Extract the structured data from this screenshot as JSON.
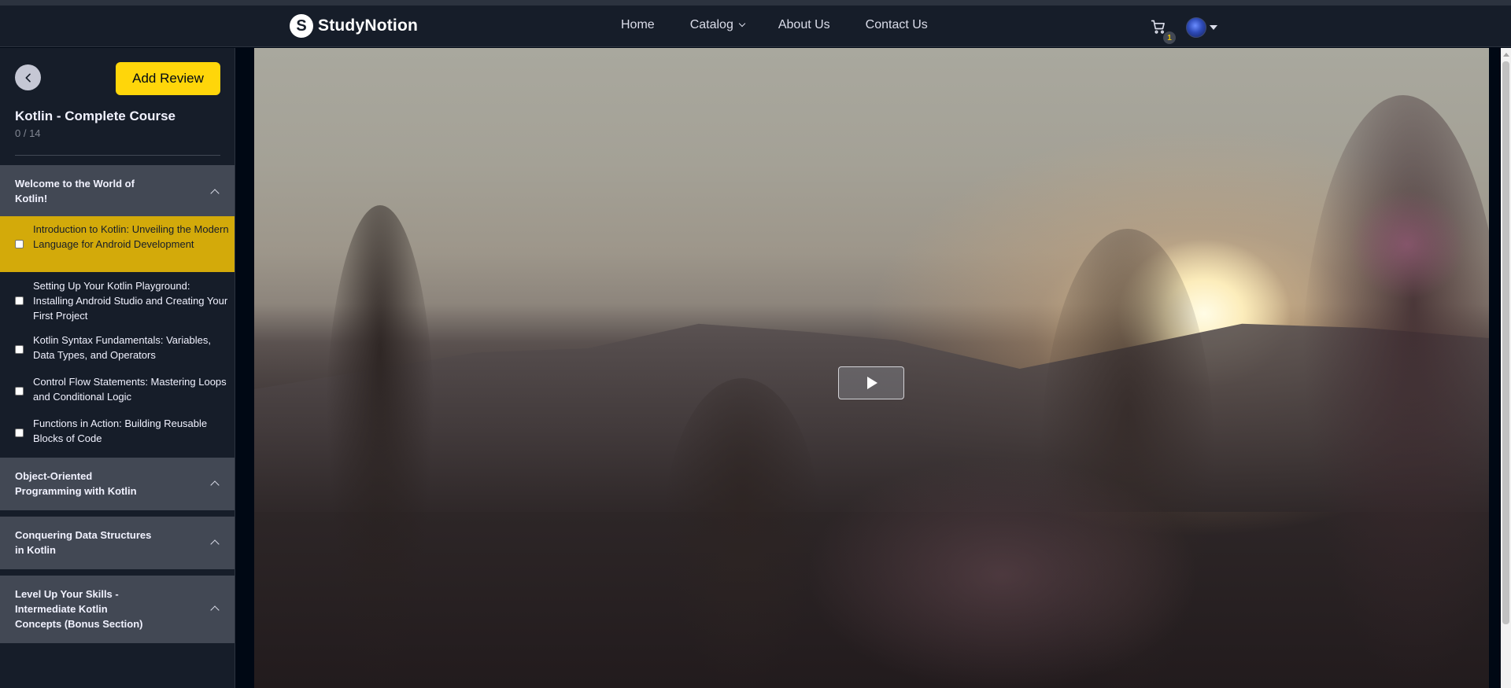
{
  "navbar": {
    "logo_letter": "S",
    "brand": "StudyNotion",
    "links": [
      {
        "label": "Home"
      },
      {
        "label": "Catalog"
      },
      {
        "label": "About Us"
      },
      {
        "label": "Contact Us"
      }
    ],
    "cart_count": "1",
    "cart_icon": "cart-icon",
    "avatar_icon": "avatar"
  },
  "sidebar": {
    "back_icon": "chevron-left-icon",
    "add_review_label": "Add Review",
    "course_title": "Kotlin - Complete Course",
    "progress": "0 / 14",
    "sections": [
      {
        "title": "Welcome to the World of Kotlin!",
        "expanded": true,
        "lectures": [
          {
            "title": "Introduction to Kotlin: Unveiling the Modern Language for Android Development",
            "active": true
          },
          {
            "title": "Setting Up Your Kotlin Playground: Installing Android Studio and Creating Your First Project"
          },
          {
            "title": "Kotlin Syntax Fundamentals: Variables, Data Types, and Operators"
          },
          {
            "title": "Control Flow Statements: Mastering Loops and Conditional Logic"
          },
          {
            "title": "Functions in Action: Building Reusable Blocks of Code"
          }
        ]
      },
      {
        "title": "Object-Oriented Programming with Kotlin",
        "expanded": false
      },
      {
        "title": "Conquering Data Structures in Kotlin",
        "expanded": false
      },
      {
        "title": "Level Up Your Skills - Intermediate Kotlin Concepts (Bonus Section)",
        "expanded": false
      }
    ]
  },
  "video": {
    "play_icon": "play-icon",
    "colors": {
      "sun": "#fffce6",
      "sky": "#a9a89e",
      "foreground": "#221b1d"
    }
  },
  "theme": {
    "accent": "#ffd60a",
    "active_lecture": "#d3aa0a",
    "sidebar_bg": "#161d29",
    "section_bg": "#424854"
  }
}
